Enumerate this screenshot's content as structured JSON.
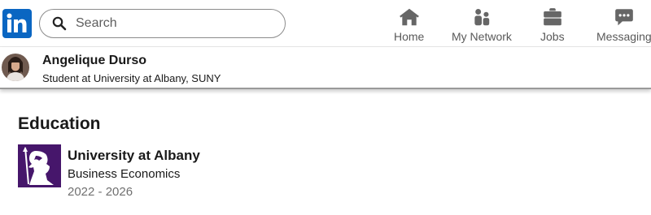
{
  "header": {
    "logo_icon": "linkedin-logo-icon",
    "search": {
      "placeholder": "Search",
      "value": ""
    },
    "nav": [
      {
        "label": "Home",
        "icon": "home-icon"
      },
      {
        "label": "My Network",
        "icon": "network-icon"
      },
      {
        "label": "Jobs",
        "icon": "briefcase-icon"
      },
      {
        "label": "Messaging",
        "icon": "messaging-icon"
      }
    ]
  },
  "profile": {
    "name": "Angelique Durso",
    "headline": "Student at University at Albany, SUNY"
  },
  "education": {
    "title": "Education",
    "items": [
      {
        "school": "University at Albany",
        "degree": "Business Economics",
        "dates": "2022 - 2026",
        "logo_color": "#46166b"
      }
    ]
  },
  "colors": {
    "brand": "#0a66c2",
    "nav_icon": "#666666",
    "muted_text": "#707070"
  }
}
